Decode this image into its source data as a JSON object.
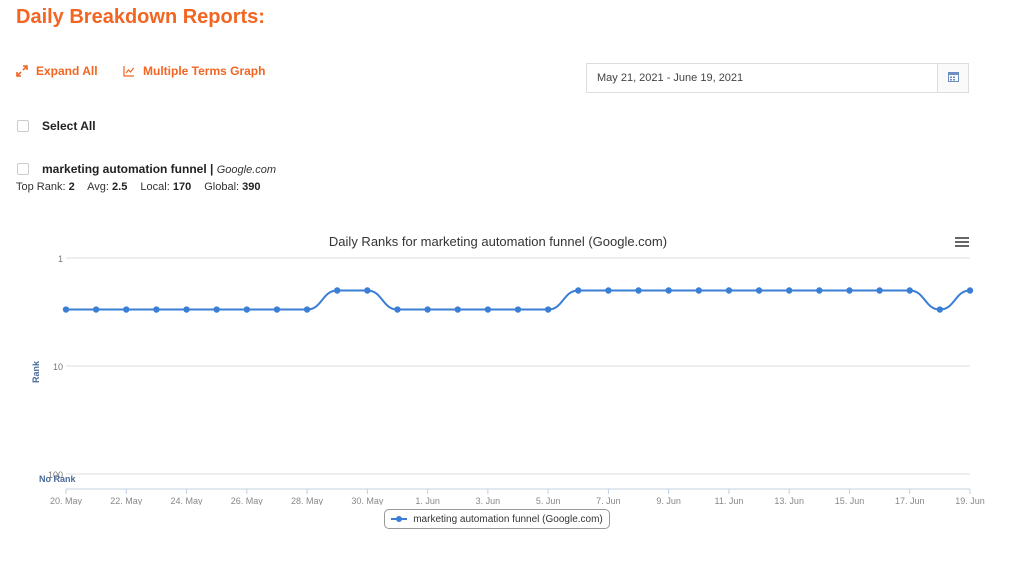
{
  "page": {
    "title": "Daily Breakdown Reports:",
    "expand_all_label": "Expand All",
    "multiple_terms_label": "Multiple Terms Graph",
    "date_range": "May 21, 2021 - June 19, 2021",
    "select_all_label": "Select All",
    "term": {
      "keyword": "marketing automation funnel",
      "separator": "|",
      "domain": "Google.com"
    },
    "stats": {
      "top_rank_label": "Top Rank:",
      "top_rank": "2",
      "avg_label": "Avg:",
      "avg": "2.5",
      "local_label": "Local:",
      "local": "170",
      "global_label": "Global:",
      "global": "390"
    },
    "icons": {
      "expand": "expand-arrows-icon",
      "graph": "line-chart-icon",
      "calendar": "calendar-icon",
      "menu": "hamburger-menu-icon"
    },
    "colors": {
      "accent": "#f26522",
      "series": "#3a7fd5"
    }
  },
  "chart_data": {
    "type": "line",
    "title": "Daily Ranks for marketing automation funnel (Google.com)",
    "ylabel": "Rank",
    "xlabel": "",
    "y_scale": "log",
    "y_reversed": true,
    "ylim": [
      1,
      100
    ],
    "y_ticks": [
      "1",
      "10",
      "100"
    ],
    "no_rank_label": "No Rank",
    "x_ticks": [
      "20. May",
      "22. May",
      "24. May",
      "26. May",
      "28. May",
      "30. May",
      "1. Jun",
      "3. Jun",
      "5. Jun",
      "7. Jun",
      "9. Jun",
      "11. Jun",
      "13. Jun",
      "15. Jun",
      "17. Jun",
      "19. Jun"
    ],
    "x": [
      "2021-05-20",
      "2021-05-21",
      "2021-05-22",
      "2021-05-23",
      "2021-05-24",
      "2021-05-25",
      "2021-05-26",
      "2021-05-27",
      "2021-05-28",
      "2021-05-29",
      "2021-05-30",
      "2021-05-31",
      "2021-06-01",
      "2021-06-02",
      "2021-06-03",
      "2021-06-04",
      "2021-06-05",
      "2021-06-06",
      "2021-06-07",
      "2021-06-08",
      "2021-06-09",
      "2021-06-10",
      "2021-06-11",
      "2021-06-12",
      "2021-06-13",
      "2021-06-14",
      "2021-06-15",
      "2021-06-16",
      "2021-06-17",
      "2021-06-18",
      "2021-06-19"
    ],
    "series": [
      {
        "name": "marketing automation funnel (Google.com)",
        "values": [
          3,
          3,
          3,
          3,
          3,
          3,
          3,
          3,
          3,
          2,
          2,
          3,
          3,
          3,
          3,
          3,
          3,
          2,
          2,
          2,
          2,
          2,
          2,
          2,
          2,
          2,
          2,
          2,
          2,
          3,
          2
        ]
      }
    ],
    "grid": true,
    "legend": "bottom-center"
  }
}
